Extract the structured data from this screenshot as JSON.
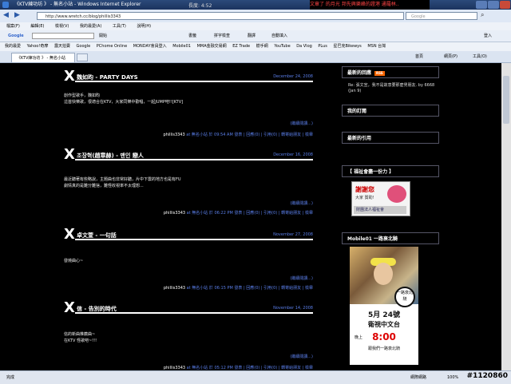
{
  "window": {
    "title": "《KTV練功坊 》 - 無名小站 - Windows Internet Explorer",
    "tray_text": "長度: 4:52",
    "banner_text": "文章了 的月光 邦先興樂峰的證港 通羅林.."
  },
  "address_bar": {
    "url": "http://www.wretch.cc/blog/phillis3343",
    "search_placeholder": "Google"
  },
  "menu": [
    "檔案(F)",
    "編輯(E)",
    "檢視(V)",
    "我的最愛(A)",
    "工具(T)",
    "說明(H)"
  ],
  "google_bar": {
    "logo": "Google",
    "go": "開始",
    "items": [
      "書籤",
      "拼字檢查",
      "翻譯",
      "自動填入"
    ],
    "signin": "登入"
  },
  "favorites": [
    "我的最愛",
    "Yahoo!奇摩",
    "露天拍賣",
    "Google",
    "PChome Online",
    "MONDAY會員登入",
    "Mobile01",
    "MMA金融交易網",
    "EZ Trade",
    "樹手網",
    "YouTube",
    "Da Vlog",
    "PLus",
    "星巴克Bikewys",
    "MSN 台灣"
  ],
  "tab": {
    "label": "《KTV練功坊 》 - 無名小站",
    "right_items": [
      "首頁",
      "網頁(P)",
      "工具(O)"
    ]
  },
  "posts": [
    {
      "title": "魏如昀 - PARTY DAYS",
      "date": "December 24, 2008",
      "body": [
        "創作型歌手，魏如昀",
        "這首快樂歌，很適合在KTV，大家同樂中歡唱，一起JUMP吧!![KTV]"
      ],
      "more": "(繼續閱讀...)",
      "meta_author": "phillis3343",
      "meta_rest": " at 無名小站 於 09:54 AM 發表 | 回應(0) | 引用(0) | 轉寄給朋友 | 檢舉"
    },
    {
      "title": "조장혁(趙章赫) - 맨인 戀人",
      "date": "December 16, 2008",
      "body": [
        "最近聽著有些略說，主題曲也非常好聽，片中下雲的地方也是有FU",
        "劇情真的是難分難捨，難怪收視率不太理想..."
      ],
      "more": "(繼續閱讀...)",
      "meta_author": "phillis3343",
      "meta_rest": " at 無名小站 於 06:22 PM 發表 | 回應(0) | 引用(0) | 轉寄給朋友 | 檢舉"
    },
    {
      "title": "卓文萱 - 一句話",
      "date": "November 27, 2008",
      "body": [
        "發燒曲心~"
      ],
      "more": "(繼續閱讀...)",
      "meta_author": "phillis3343",
      "meta_rest": " at 無名小站 於 06:15 PM 發表 | 回應(0) | 引用(0) | 轉寄給朋友 | 檢舉"
    },
    {
      "title": "信 - 告別的時代",
      "date": "November 14, 2008",
      "body": [
        "信的新曲推薦曲~",
        "在KTV 怪歌吧~!!!"
      ],
      "more": "(繼續閱讀...)",
      "meta_author": "phillis3343",
      "meta_rest": " at 無名小站 於 05:12 PM 發表 | 回應(0) | 引用(0) | 轉寄給朋友 | 檢舉"
    }
  ],
  "sidebar": {
    "latest_comments": {
      "title": "最新的回應",
      "rss": "RSS",
      "text": "Re: 張文宣，我不是故意要那麼男朋友. by 6668 (Jan 9)"
    },
    "subscriptions": {
      "title": "我的訂閱"
    },
    "latest_trackbacks": {
      "title": "最新的引用"
    },
    "charity": {
      "title": "【 福祉會盡一份力 】",
      "ad_red": "謝謝您",
      "ad_line": "大家 贊助!",
      "ad_bottom": "財團法人福祉會"
    },
    "mobile01": {
      "title": "Mobile01 一路衰北騎",
      "stamp": "一路衰北騎",
      "date": "5月 24號",
      "channel": "衛視中文台",
      "prefix": "晚上",
      "time": "8:00",
      "footer": "跟我們一路衰北騎"
    }
  },
  "status": {
    "left": "完成",
    "zone": "網際網路",
    "zoom": "100%"
  },
  "watermark": "#1120860"
}
